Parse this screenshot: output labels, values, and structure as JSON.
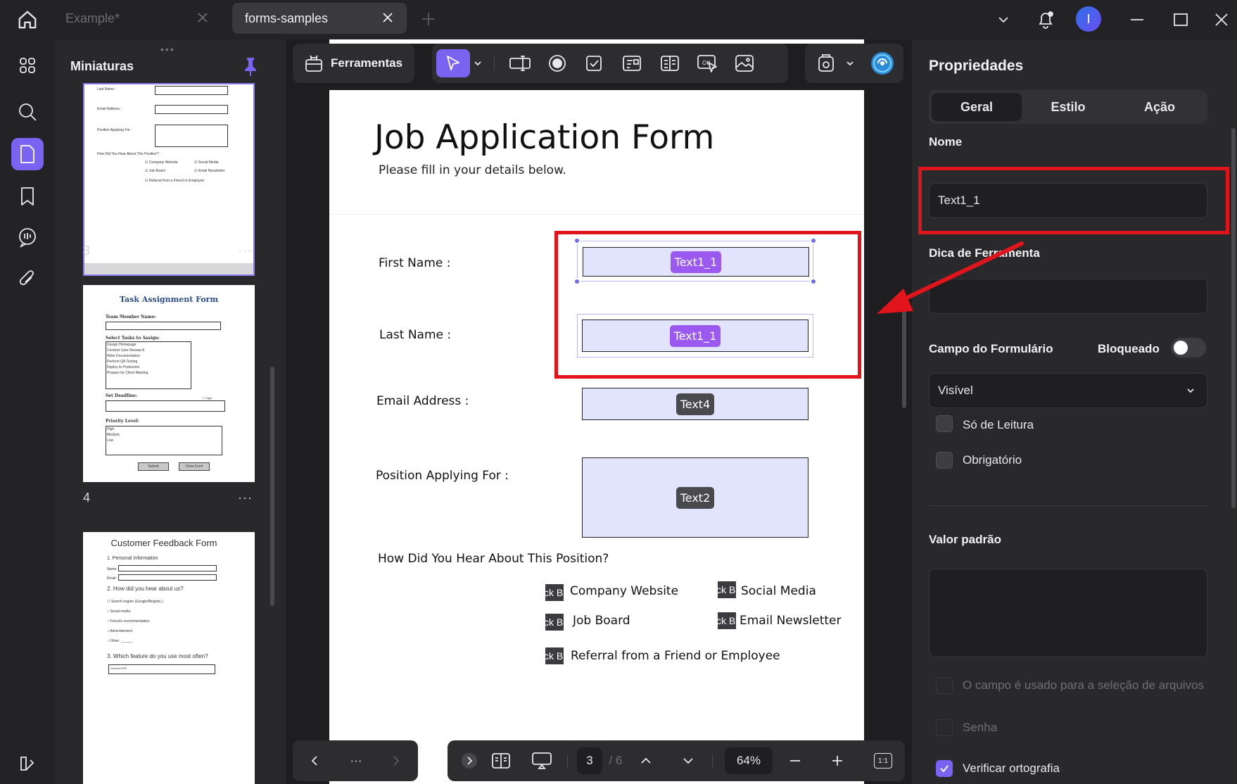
{
  "tabs": [
    {
      "label": "Example*",
      "active": false
    },
    {
      "label": "forms-samples",
      "active": true
    }
  ],
  "user": {
    "avatar_initial": "I"
  },
  "thumbnails_panel": {
    "title": "Miniaturas",
    "pages": [
      {
        "number": "3",
        "mini_texts": [
          "Last Name :",
          "Email Address :",
          "Position Applying For :",
          "How Did You Hear About This Position?",
          "Company Website",
          "Social Media",
          "Job Board",
          "Email Newsletter",
          "Referral from a Friend or Employee"
        ]
      },
      {
        "number": "4",
        "mini_texts": [
          "Task Assignment Form",
          "Team Member Name:",
          "Select Tasks to Assign:",
          "Design Homepage",
          "Conduct User Research",
          "Write Documentation",
          "Perform QA Testing",
          "Deploy to Production",
          "Prepare for Client Meeting",
          "Set Deadline:",
          "High",
          "Priority Level:",
          "High",
          "Medium",
          "Low",
          "Submit",
          "Clear Form"
        ]
      },
      {
        "number": "",
        "mini_texts": [
          "Customer Feedback Form",
          "1. Personal Information",
          "Name:",
          "Email:",
          "2. How did you hear about us?",
          "Search engine (Google/Bing/etc.)",
          "Social media",
          "Friend's recommendation",
          "Advertisement",
          "Other: ______",
          "3. Which feature do you use most often?",
          "Convert PDF"
        ]
      }
    ],
    "more_label": "···"
  },
  "toolbar": {
    "tools_label": "Ferramentas"
  },
  "document": {
    "title": "Job Application Form",
    "subtitle": "Please fill in your details below.",
    "fields": [
      {
        "label": "First Name :",
        "field_name": "Text1_1"
      },
      {
        "label": "Last Name :",
        "field_name": "Text1_1"
      },
      {
        "label": "Email Address :",
        "field_name": "Text4"
      },
      {
        "label": "Position Applying For :",
        "field_name": "Text2"
      }
    ],
    "question": "How Did You Hear About This Position?",
    "checkbox_tag": "ck B",
    "checkboxes": [
      "Company Website",
      "Social Media",
      "Job Board",
      "Email Newsletter",
      "Referral from a Friend or Employee"
    ]
  },
  "bottom_bar": {
    "nav_more": "···",
    "current_page": "3",
    "total_pages": "/ 6",
    "zoom": "64%",
    "fit_label": "1:1"
  },
  "properties": {
    "title": "Propriedades",
    "tabs": [
      "Geral",
      "Estilo",
      "Ação"
    ],
    "active_tab": "Geral",
    "name_label": "Nome",
    "name_value": "Text1_1",
    "tooltip_label": "Dica de Ferramenta",
    "tooltip_value": "",
    "form_field_label": "Campo do Formulário",
    "locked_label": "Bloqueado",
    "visibility_value": "Visível",
    "read_only_label": "Só de Leitura",
    "required_label": "Obrigatório",
    "default_value_label": "Valor padrão",
    "file_select_label": "O campo é usado para a seleção de arquivos",
    "password_label": "Senha",
    "spellcheck_label": "Verificar ortografia",
    "spellcheck_checked": true
  },
  "colors": {
    "accent": "#7b63f2",
    "annotation_red": "#e1141c",
    "field_fill": "#e2e3fd"
  }
}
